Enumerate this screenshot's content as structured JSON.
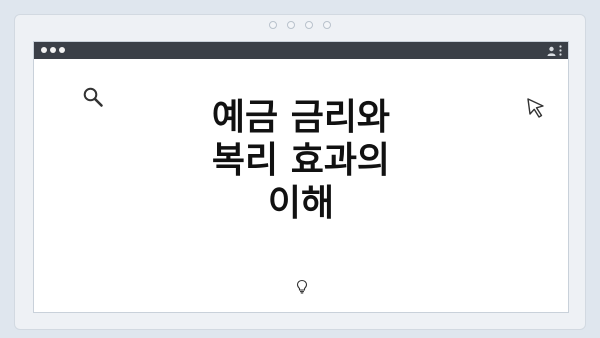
{
  "headline": {
    "lines": [
      "예금 금리와",
      "복리 효과의",
      "이해"
    ]
  },
  "icons": {
    "top_dots": "dot-indicator-icon",
    "window_controls": "window-dot-icon",
    "user": "user-icon",
    "menu": "kebab-menu-icon",
    "search": "search-icon",
    "cursor": "cursor-pointer-icon",
    "small": "lightbulb-icon"
  },
  "colors": {
    "background": "#dfe6ee",
    "titlebar": "#3a3f47",
    "page": "#ffffff",
    "text": "#111111"
  }
}
